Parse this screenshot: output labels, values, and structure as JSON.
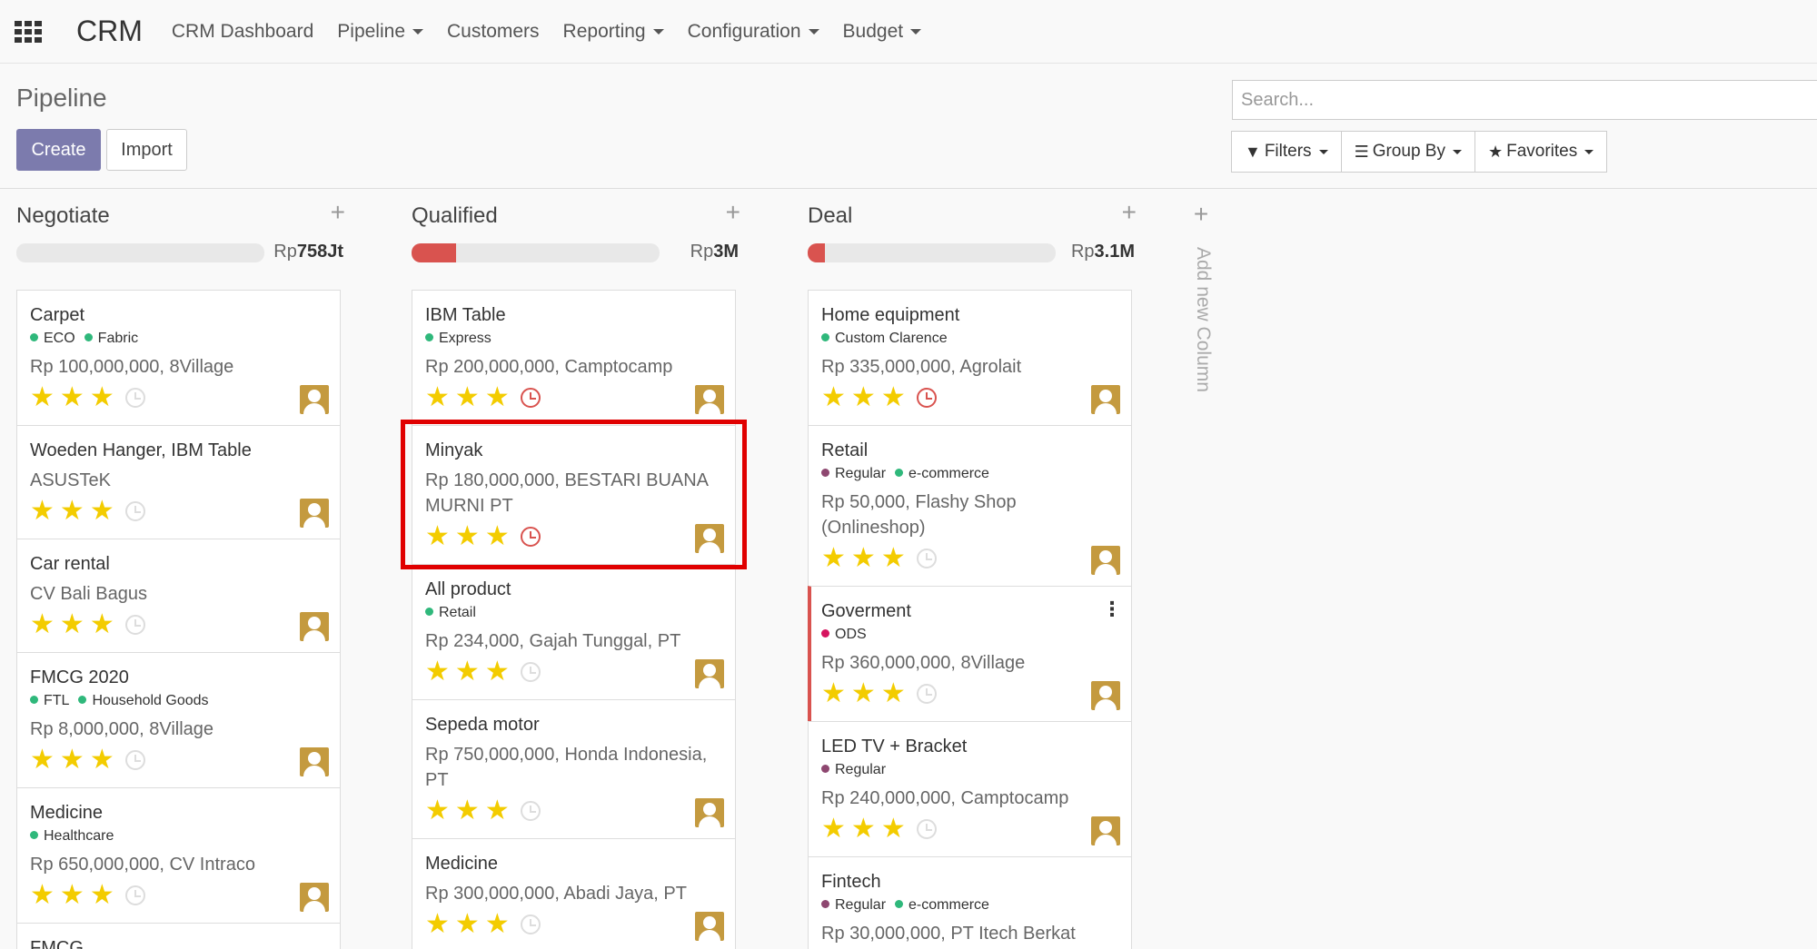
{
  "nav": {
    "app_title": "CRM",
    "items": [
      {
        "label": "CRM Dashboard",
        "caret": false
      },
      {
        "label": "Pipeline",
        "caret": true
      },
      {
        "label": "Customers",
        "caret": false
      },
      {
        "label": "Reporting",
        "caret": true
      },
      {
        "label": "Configuration",
        "caret": true
      },
      {
        "label": "Budget",
        "caret": true
      }
    ]
  },
  "control_panel": {
    "title": "Pipeline",
    "create_label": "Create",
    "import_label": "Import",
    "search_placeholder": "Search...",
    "filters_label": "Filters",
    "groupby_label": "Group By",
    "favorites_label": "Favorites"
  },
  "columns": [
    {
      "title": "Negotiate",
      "sum_prefix": "Rp",
      "sum_value": "758Jt",
      "progress_fraction": 0.0,
      "cards": [
        {
          "name": "Carpet",
          "tags": [
            {
              "label": "ECO",
              "color": "#2fb87b"
            },
            {
              "label": "Fabric",
              "color": "#2fb87b"
            }
          ],
          "sub": "Rp 100,000,000, 8Village",
          "stars": 3,
          "activity": "none"
        },
        {
          "name": "Woeden Hanger, IBM Table",
          "tags": [],
          "sub": "ASUSTeK",
          "stars": 3,
          "activity": "none"
        },
        {
          "name": "Car rental",
          "tags": [],
          "sub": "CV Bali Bagus",
          "stars": 3,
          "activity": "none"
        },
        {
          "name": "FMCG 2020",
          "tags": [
            {
              "label": "FTL",
              "color": "#2fb87b"
            },
            {
              "label": "Household Goods",
              "color": "#2fb87b"
            }
          ],
          "sub": "Rp 8,000,000, 8Village",
          "stars": 3,
          "activity": "none"
        },
        {
          "name": "Medicine",
          "tags": [
            {
              "label": "Healthcare",
              "color": "#2fb87b"
            }
          ],
          "sub": "Rp 650,000,000, CV Intraco",
          "stars": 3,
          "activity": "none"
        },
        {
          "name": "FMCG",
          "tags": [],
          "sub": "",
          "stars": 0,
          "activity": "none"
        }
      ]
    },
    {
      "title": "Qualified",
      "sum_prefix": "Rp",
      "sum_value": "3M",
      "progress_fraction": 0.18,
      "cards": [
        {
          "name": "IBM Table",
          "tags": [
            {
              "label": "Express",
              "color": "#2fb87b"
            }
          ],
          "sub": "Rp 200,000,000, Camptocamp",
          "stars": 3,
          "activity": "overdue"
        },
        {
          "name": "Minyak",
          "tags": [],
          "sub": "Rp 180,000,000, BESTARI BUANA MURNI PT",
          "stars": 3,
          "activity": "overdue",
          "highlighted": true
        },
        {
          "name": "All product",
          "tags": [
            {
              "label": "Retail",
              "color": "#2fb87b"
            }
          ],
          "sub": "Rp 234,000, Gajah Tunggal, PT",
          "stars": 3,
          "activity": "none"
        },
        {
          "name": "Sepeda motor",
          "tags": [],
          "sub": "Rp 750,000,000, Honda Indonesia, PT",
          "stars": 3,
          "activity": "none"
        },
        {
          "name": "Medicine",
          "tags": [],
          "sub": "Rp 300,000,000, Abadi Jaya, PT",
          "stars": 3,
          "activity": "none"
        }
      ]
    },
    {
      "title": "Deal",
      "sum_prefix": "Rp",
      "sum_value": "3.1M",
      "progress_fraction": 0.07,
      "cards": [
        {
          "name": "Home equipment",
          "tags": [
            {
              "label": "Custom Clarence",
              "color": "#2fb87b"
            }
          ],
          "sub": "Rp 335,000,000, Agrolait",
          "stars": 3,
          "activity": "overdue"
        },
        {
          "name": "Retail",
          "tags": [
            {
              "label": "Regular",
              "color": "#8e4770"
            },
            {
              "label": "e-commerce",
              "color": "#2fb87b"
            }
          ],
          "sub": "Rp 50,000, Flashy Shop (Onlineshop)",
          "stars": 3,
          "activity": "none"
        },
        {
          "name": "Goverment",
          "tags": [
            {
              "label": "ODS",
              "color": "#d6145f"
            }
          ],
          "sub": "Rp 360,000,000, 8Village",
          "stars": 3,
          "activity": "none",
          "alert": true
        },
        {
          "name": "LED TV + Bracket",
          "tags": [
            {
              "label": "Regular",
              "color": "#8e4770"
            }
          ],
          "sub": "Rp 240,000,000, Camptocamp",
          "stars": 3,
          "activity": "none"
        },
        {
          "name": "Fintech",
          "tags": [
            {
              "label": "Regular",
              "color": "#8e4770"
            },
            {
              "label": "e-commerce",
              "color": "#2fb87b"
            }
          ],
          "sub": "Rp 30,000,000, PT Itech Berkat",
          "stars": 0,
          "activity": "none"
        }
      ]
    }
  ],
  "add_column_label": "Add new Column"
}
